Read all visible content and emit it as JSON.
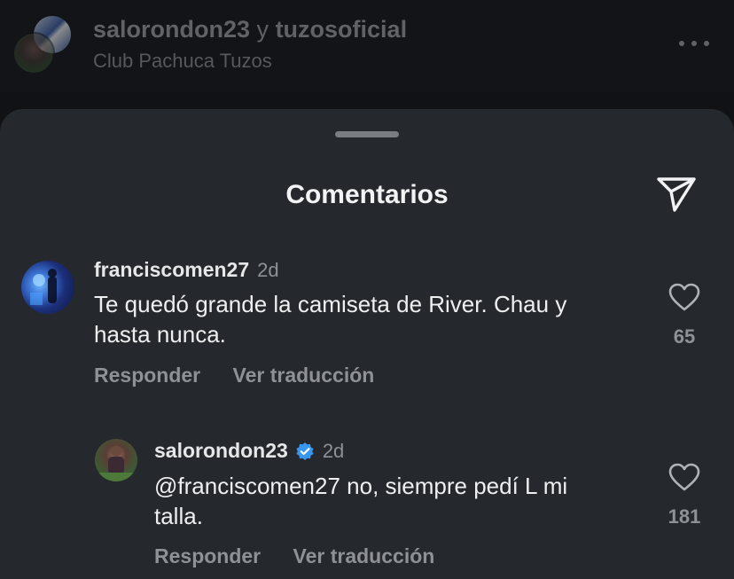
{
  "post_header": {
    "user1": "salorondon23",
    "connector": "y",
    "user2": "tuzosoficial",
    "subtitle": "Club Pachuca Tuzos",
    "more_icon": "more-horizontal-icon"
  },
  "sheet": {
    "title": "Comentarios",
    "share_icon": "send-icon"
  },
  "comments": [
    {
      "username": "franciscomen27",
      "time": "2d",
      "verified": false,
      "text_line1": "Te quedó grande la camiseta de River. Chau  y",
      "text_line2": "hasta nunca.",
      "reply_label": "Responder",
      "translate_label": "Ver traducción",
      "likes": "65"
    },
    {
      "username": "salorondon23",
      "time": "2d",
      "verified": true,
      "text_line1": "@franciscomen27 no, siempre pedí L mi",
      "text_line2": "talla.",
      "reply_label": "Responder",
      "translate_label": "Ver traducción",
      "likes": "181"
    }
  ],
  "colors": {
    "sheet_bg": "#25282c",
    "verified": "#3897f0",
    "muted_text": "#8e9196"
  }
}
